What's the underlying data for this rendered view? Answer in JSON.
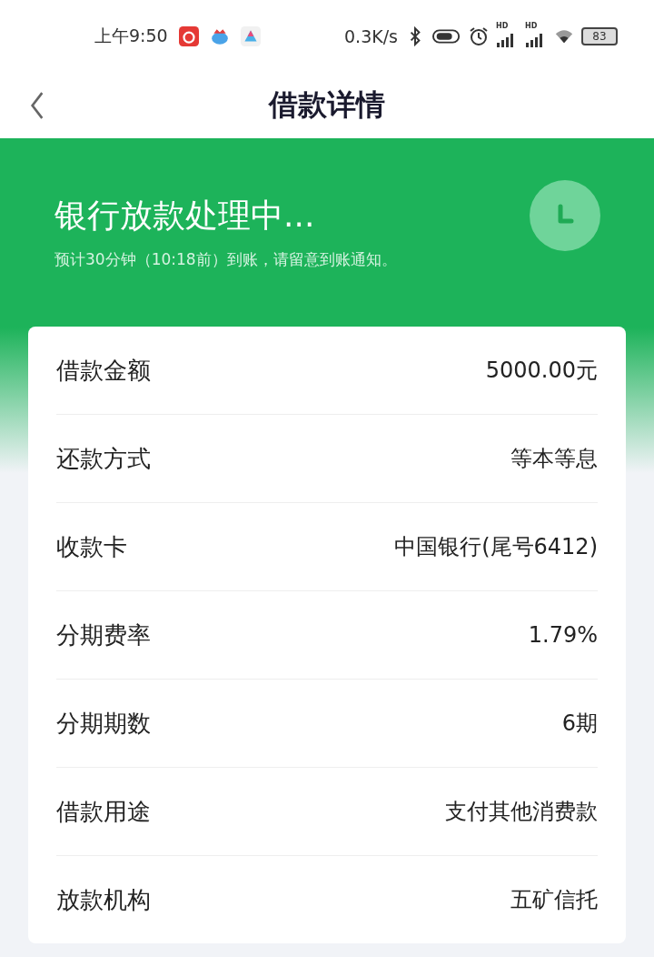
{
  "status_bar": {
    "time": "上午9:50",
    "net_speed": "0.3K/s",
    "signals": [
      {
        "label": "HD"
      },
      {
        "label": "HD"
      }
    ],
    "battery": "83"
  },
  "header": {
    "title": "借款详情"
  },
  "banner": {
    "title": "银行放款处理中...",
    "subtitle": "预计30分钟（10:18前）到账，请留意到账通知。"
  },
  "details": [
    {
      "label": "借款金额",
      "value": "5000.00元"
    },
    {
      "label": "还款方式",
      "value": "等本等息"
    },
    {
      "label": "收款卡",
      "value": "中国银行(尾号6412)"
    },
    {
      "label": "分期费率",
      "value": "1.79%"
    },
    {
      "label": "分期期数",
      "value": "6期"
    },
    {
      "label": "借款用途",
      "value": "支付其他消费款"
    },
    {
      "label": "放款机构",
      "value": "五矿信托"
    }
  ]
}
